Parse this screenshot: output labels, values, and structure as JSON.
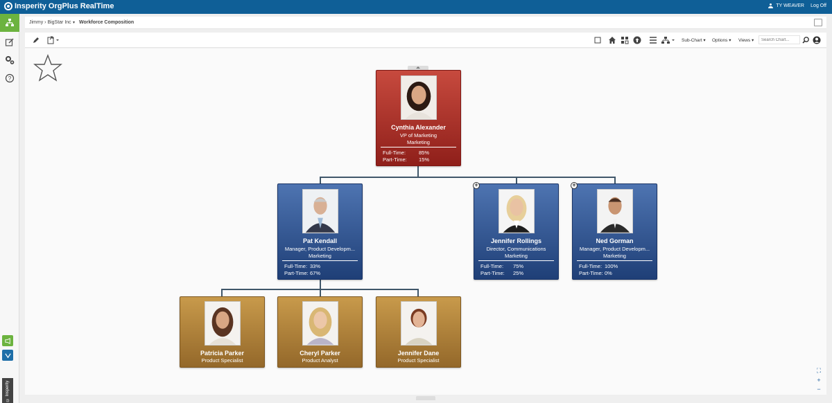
{
  "app": {
    "title": "Insperity OrgPlus RealTime"
  },
  "user": {
    "name": "TY WEAVER",
    "logoff": "Log Off"
  },
  "breadcrumb": {
    "path": "Jimmy › BigStar Inc",
    "current": "Workforce Composition"
  },
  "toolbar": {
    "subchart": "Sub-Chart ▾",
    "options": "Options ▾",
    "views": "Views ▾",
    "search_placeholder": "Search Chart..."
  },
  "sidebar": {
    "vertical_tag": "© Insperity"
  },
  "colors": {
    "topbar": "#0f5f97",
    "active_nav": "#6cb33f",
    "exec_card": "#b73a30",
    "manager_card": "#2f5592",
    "staff_card": "#b5873b"
  },
  "chart": {
    "root": {
      "name": "Cynthia Alexander",
      "title": "VP of Marketing",
      "dept": "Marketing",
      "ft_label": "Full-Time:",
      "ft": "85%",
      "pt_label": "Part-Time:",
      "pt": "15%"
    },
    "managers": [
      {
        "name": "Pat Kendall",
        "title": "Manager, Product Developm...",
        "dept": "Marketing",
        "ft_label": "Full-Time:",
        "ft": "33%",
        "pt_label": "Part-Time:",
        "pt": "67%"
      },
      {
        "name": "Jennifer Rollings",
        "title": "Director, Communications",
        "dept": "Marketing",
        "ft_label": "Full-Time:",
        "ft": "75%",
        "pt_label": "Part-Time:",
        "pt": "25%"
      },
      {
        "name": "Ned Gorman",
        "title": "Manager, Product Developm...",
        "dept": "Marketing",
        "ft_label": "Full-Time:",
        "ft": "100%",
        "pt_label": "Part-Time:",
        "pt": "0%"
      }
    ],
    "staff": [
      {
        "name": "Patricia Parker",
        "title": "Product Specialist"
      },
      {
        "name": "Cheryl Parker",
        "title": "Product Analyst"
      },
      {
        "name": "Jennifer Dane",
        "title": "Product Specialist"
      }
    ]
  }
}
